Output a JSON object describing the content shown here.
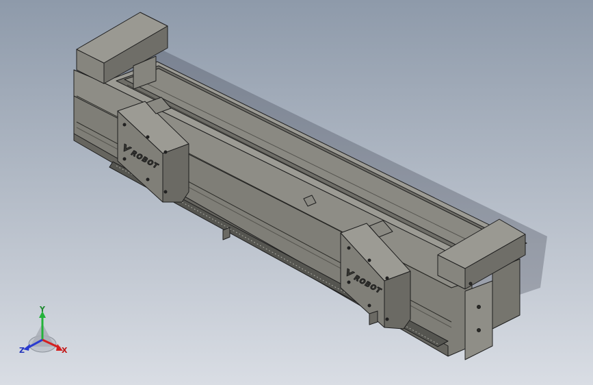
{
  "viewport": {
    "background_top": "#8e9aaa",
    "background_bottom": "#d9dde4"
  },
  "model": {
    "logo_text_left": "ROBOT",
    "logo_text_right": "ROBOT",
    "colors": {
      "housing": "#807f77",
      "housing_dark": "#5d5c56",
      "housing_light": "#9a9991",
      "rail": "#8d8c85",
      "edge": "#202020"
    }
  },
  "triad": {
    "x_label": "X",
    "y_label": "Y",
    "z_label": "Z",
    "x_color": "#d42020",
    "y_color": "#23b23a",
    "z_color": "#2a3bd0"
  }
}
